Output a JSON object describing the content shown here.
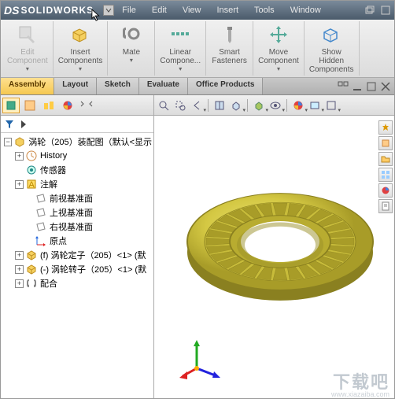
{
  "menubar": {
    "items": [
      "File",
      "Edit",
      "View",
      "Insert",
      "Tools",
      "Window"
    ]
  },
  "ribbon": {
    "groups": [
      {
        "label": "Edit\nComponent",
        "icon": "edit-component-icon",
        "disabled": true,
        "dd": true
      },
      {
        "label": "Insert\nComponents",
        "icon": "insert-components-icon",
        "dd": true
      },
      {
        "label": "Mate",
        "icon": "mate-icon",
        "dd": true
      },
      {
        "label": "Linear\nCompone...",
        "icon": "linear-pattern-icon",
        "dd": true
      },
      {
        "label": "Smart\nFasteners",
        "icon": "smart-fasteners-icon"
      },
      {
        "label": "Move\nComponent",
        "icon": "move-component-icon",
        "dd": true
      },
      {
        "label": "Show\nHidden\nComponents",
        "icon": "show-hidden-icon"
      }
    ]
  },
  "tabs": {
    "items": [
      "Assembly",
      "Layout",
      "Sketch",
      "Evaluate",
      "Office Products"
    ],
    "active": 0
  },
  "tree": {
    "root": "涡轮（205）装配图（默认<显示",
    "items": [
      {
        "icon": "history-icon",
        "label": "History",
        "exp": "+",
        "indent": 1
      },
      {
        "icon": "sensor-icon",
        "label": "传感器",
        "indent": 1
      },
      {
        "icon": "annotation-icon",
        "label": "注解",
        "exp": "+",
        "indent": 1
      },
      {
        "icon": "plane-icon",
        "label": "前视基准面",
        "indent": 2
      },
      {
        "icon": "plane-icon",
        "label": "上视基准面",
        "indent": 2
      },
      {
        "icon": "plane-icon",
        "label": "右视基准面",
        "indent": 2
      },
      {
        "icon": "origin-icon",
        "label": "原点",
        "indent": 2
      },
      {
        "icon": "part-icon",
        "label": "(f) 涡轮定子（205）<1> (默",
        "exp": "+",
        "indent": 1
      },
      {
        "icon": "part-icon",
        "label": "(-) 涡轮转子（205）<1> (默",
        "exp": "+",
        "indent": 1
      },
      {
        "icon": "mates-icon",
        "label": "配合",
        "exp": "+",
        "indent": 1
      }
    ]
  },
  "watermark": {
    "main": "下载吧",
    "sub": "www.xiazaiba.com"
  },
  "colors": {
    "ring": "#d4c843",
    "ring_shadow": "#a89c28",
    "ring_light": "#e8e070"
  }
}
